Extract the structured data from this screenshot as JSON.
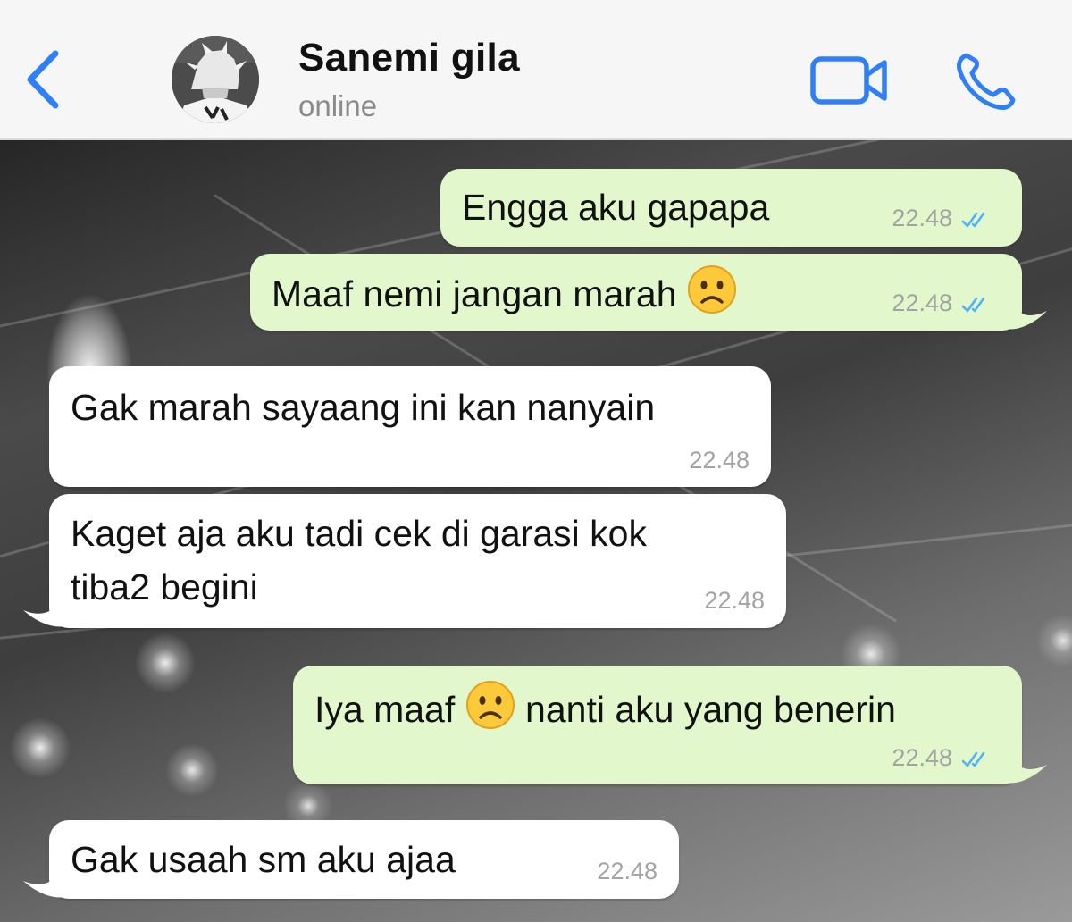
{
  "header": {
    "contact_name": "Sanemi gila",
    "status": "online"
  },
  "colors": {
    "accent": "#2f7ff6",
    "outgoing_bubble": "#e2f7cb",
    "incoming_bubble": "#ffffff",
    "read_ticks": "#4fb3f6"
  },
  "icons": {
    "back": "chevron-left-icon",
    "video": "video-camera-icon",
    "call": "phone-icon",
    "read_receipt": "double-check-icon",
    "emoji": "frowning-face-emoji"
  },
  "messages": [
    {
      "direction": "out",
      "parts": [
        "Engga aku gapapa"
      ],
      "time": "22.48",
      "read": true
    },
    {
      "direction": "out",
      "parts": [
        "Maaf nemi jangan marah ",
        ""
      ],
      "emoji": "☹️",
      "time": "22.48",
      "read": true
    },
    {
      "direction": "in",
      "parts": [
        "Gak marah sayaang ini kan nanyain"
      ],
      "time": "22.48"
    },
    {
      "direction": "in",
      "parts": [
        "Kaget aja aku tadi cek di garasi kok",
        "tiba2 begini"
      ],
      "time": "22.48"
    },
    {
      "direction": "out",
      "parts": [
        "Iya maaf ",
        " nanti aku yang benerin"
      ],
      "emoji": "☹️",
      "time": "22.48",
      "read": true
    },
    {
      "direction": "in",
      "parts": [
        "Gak usaah sm aku ajaa"
      ],
      "time": "22.48"
    }
  ]
}
